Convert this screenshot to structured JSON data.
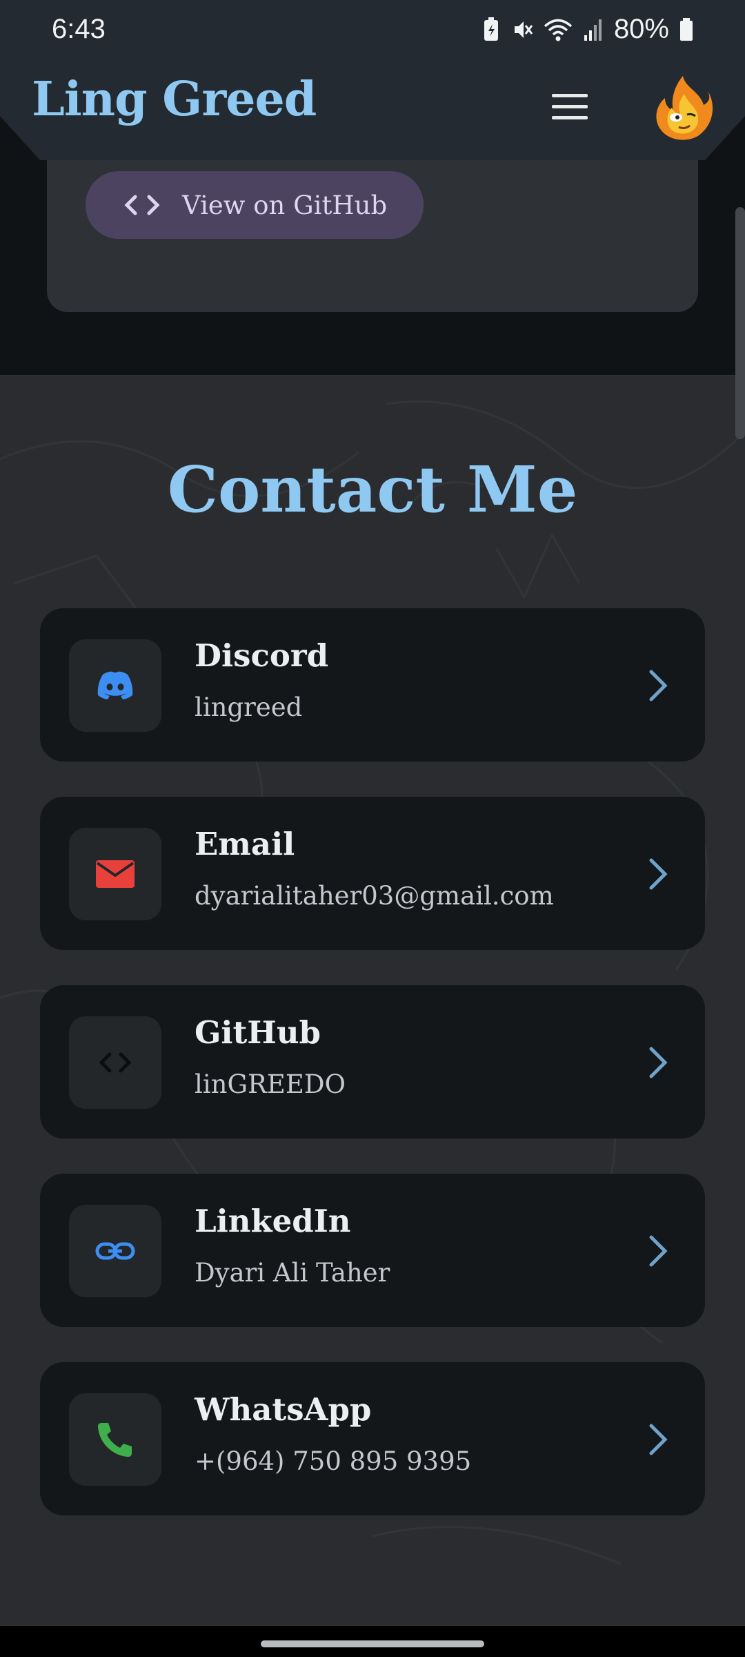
{
  "status_bar": {
    "time": "6:43",
    "battery_percent": "80%",
    "icons": [
      "battery-saver-icon",
      "mute-icon",
      "wifi-icon",
      "signal-icon",
      "battery-icon"
    ]
  },
  "header": {
    "brand": "Ling Greed",
    "menu_icon": "hamburger-menu-icon",
    "avatar_icon": "flame-mascot-icon"
  },
  "project_card": {
    "github_button_label": "View on GitHub",
    "github_button_icon": "code-icon"
  },
  "contact": {
    "title": "Contact Me",
    "items": [
      {
        "title": "Discord",
        "value": "lingreed",
        "icon": "discord-icon",
        "icon_color": "#3d8ef2"
      },
      {
        "title": "Email",
        "value": "dyarialitaher03@gmail.com",
        "icon": "mail-icon",
        "icon_color": "#e8413b"
      },
      {
        "title": "GitHub",
        "value": "linGREEDO",
        "icon": "code-icon",
        "icon_color": "#0c0d0e"
      },
      {
        "title": "LinkedIn",
        "value": "Dyari Ali Taher",
        "icon": "link-icon",
        "icon_color": "#3d8ef2"
      },
      {
        "title": "WhatsApp",
        "value": "+(964) 750 895 9395",
        "icon": "phone-icon",
        "icon_color": "#3fae4c"
      }
    ]
  },
  "colors": {
    "accent": "#8fc9f2",
    "card_bg": "#14171a",
    "button_bg": "#4b4360"
  }
}
